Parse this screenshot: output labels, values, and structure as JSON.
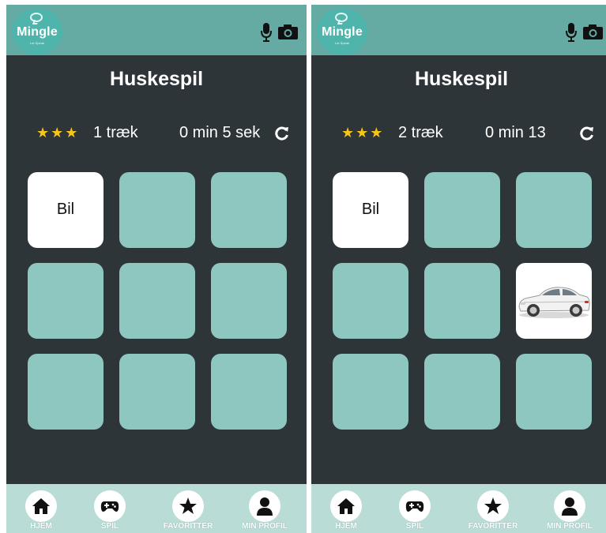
{
  "app": {
    "logo_name": "Mingle",
    "logo_tagline": "Let Speak",
    "title": "Huskespil"
  },
  "colors": {
    "header": "#66aaa4",
    "background": "#2e3538",
    "card_hidden": "#8ec7c0",
    "card_revealed": "#ffffff",
    "nav_bar": "#b9dcd6",
    "star": "#f5c518"
  },
  "screens": [
    {
      "rating_stars": "★★★",
      "moves": "1 træk",
      "time": "0 min 5 sek",
      "cards": [
        {
          "state": "text",
          "text": "Bil"
        },
        {
          "state": "hidden"
        },
        {
          "state": "hidden"
        },
        {
          "state": "hidden"
        },
        {
          "state": "hidden"
        },
        {
          "state": "hidden"
        },
        {
          "state": "hidden"
        },
        {
          "state": "hidden"
        },
        {
          "state": "hidden"
        }
      ]
    },
    {
      "rating_stars": "★★★",
      "moves": "2 træk",
      "time": "0 min 13",
      "cards": [
        {
          "state": "text",
          "text": "Bil"
        },
        {
          "state": "hidden"
        },
        {
          "state": "hidden"
        },
        {
          "state": "hidden"
        },
        {
          "state": "hidden"
        },
        {
          "state": "image",
          "icon": "car-image"
        },
        {
          "state": "hidden"
        },
        {
          "state": "hidden"
        },
        {
          "state": "hidden"
        }
      ]
    }
  ],
  "nav": [
    {
      "label": "HJEM",
      "icon": "home-icon"
    },
    {
      "label": "SPIL",
      "icon": "gamepad-icon"
    },
    {
      "label": "FAVORITTER",
      "icon": "star-icon"
    },
    {
      "label": "MIN PROFIL",
      "icon": "user-icon"
    }
  ],
  "header_icons": [
    "microphone-icon",
    "camera-icon"
  ]
}
